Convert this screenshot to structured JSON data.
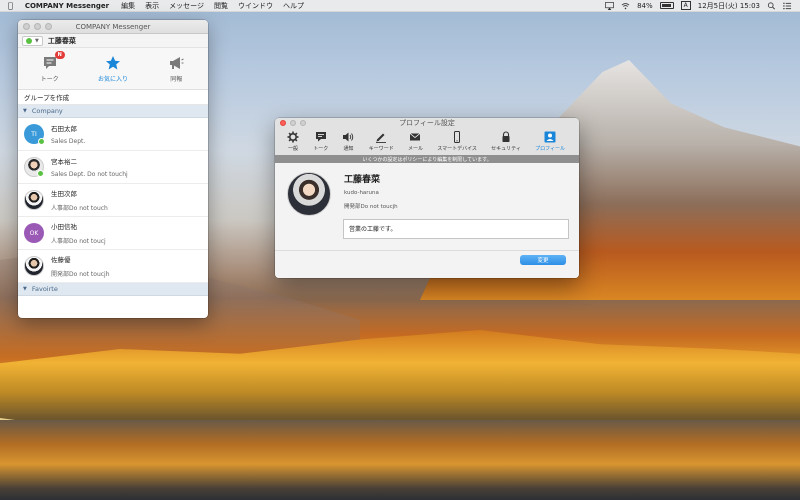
{
  "menubar": {
    "app_name": "COMPANY Messenger",
    "items": [
      "編集",
      "表示",
      "メッセージ",
      "閲覧",
      "ウインドウ",
      "ヘルプ"
    ],
    "battery": "84%",
    "input_method": "A",
    "datetime": "12月5日(火) 15:03"
  },
  "messenger": {
    "title": "COMPANY Messenger",
    "username": "工藤春菜",
    "tabs": [
      {
        "label": "トーク",
        "badge": "N",
        "icon": "chat-icon"
      },
      {
        "label": "お気に入り",
        "icon": "star-icon"
      },
      {
        "label": "同報",
        "icon": "megaphone-icon"
      }
    ],
    "create_group": "グループを作成",
    "sections": {
      "company": "Company",
      "favorite": "Favoirte"
    },
    "contacts": [
      {
        "name": "石田太郎",
        "status": "Sales Dept.",
        "initials": "TI"
      },
      {
        "name": "宮本裕二",
        "status": "Sales Dept. Do not touchj"
      },
      {
        "name": "生田次郎",
        "status": "人事部Do not touch"
      },
      {
        "name": "小田信祐",
        "status": "人事部Do not toucj",
        "initials": "OK"
      },
      {
        "name": "佐藤優",
        "status": "開発部Do not toucjh"
      }
    ]
  },
  "profile_settings": {
    "title": "プロフィール設定",
    "toolbar": [
      {
        "label": "一般",
        "icon": "gear-icon"
      },
      {
        "label": "トーク",
        "icon": "chat-icon"
      },
      {
        "label": "通知",
        "icon": "speaker-icon"
      },
      {
        "label": "キーワード",
        "icon": "pen-icon"
      },
      {
        "label": "メール",
        "icon": "mail-icon"
      },
      {
        "label": "スマートデバイス",
        "icon": "phone-icon"
      },
      {
        "label": "セキュリティ",
        "icon": "lock-icon"
      },
      {
        "label": "プロフィール",
        "icon": "profile-icon"
      }
    ],
    "policy_notice": "いくつかの設定はポリシーにより編集を制限しています。",
    "name": "工藤春菜",
    "user_id": "kudo-haruna",
    "status": "開発部Do not toucjh",
    "memo": "営業の工藤です。",
    "change_button": "変更"
  },
  "colors": {
    "accent": "#1a86d9",
    "online": "#5ac142",
    "badge": "#e33a3a"
  }
}
